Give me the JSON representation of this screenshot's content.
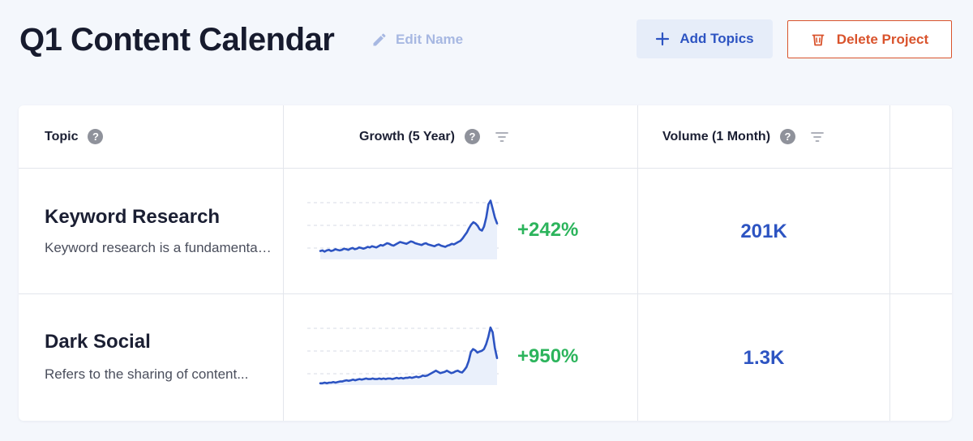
{
  "header": {
    "title": "Q1 Content Calendar",
    "edit_label": "Edit Name",
    "add_topics_label": "Add Topics",
    "delete_project_label": "Delete Project"
  },
  "table": {
    "columns": [
      "Topic",
      "Growth (5 Year)",
      "Volume (1 Month)"
    ],
    "help_glyph": "?",
    "rows": [
      {
        "name": "Keyword Research",
        "description": "Keyword research is a fundamental...",
        "growth": "+242%",
        "volume": "201K",
        "trend": [
          14,
          15,
          13,
          15,
          16,
          14,
          15,
          17,
          16,
          15,
          16,
          18,
          17,
          16,
          18,
          19,
          17,
          18,
          20,
          19,
          18,
          19,
          21,
          20,
          22,
          21,
          20,
          22,
          24,
          23,
          25,
          27,
          26,
          24,
          23,
          25,
          27,
          29,
          28,
          27,
          26,
          28,
          30,
          29,
          27,
          26,
          25,
          24,
          26,
          27,
          25,
          24,
          23,
          22,
          24,
          25,
          23,
          22,
          21,
          23,
          24,
          26,
          25,
          27,
          29,
          31,
          35,
          40,
          45,
          52,
          58,
          62,
          60,
          56,
          50,
          48,
          55,
          70,
          92,
          98,
          84,
          70,
          60
        ]
      },
      {
        "name": "Dark Social",
        "description": "Refers to the sharing of content...",
        "growth": "+950%",
        "volume": "1.3K",
        "trend": [
          3,
          3,
          4,
          3,
          4,
          4,
          5,
          4,
          5,
          6,
          6,
          7,
          8,
          7,
          8,
          9,
          8,
          9,
          10,
          9,
          10,
          11,
          10,
          10,
          11,
          10,
          10,
          11,
          10,
          11,
          10,
          11,
          11,
          10,
          11,
          12,
          11,
          12,
          11,
          12,
          12,
          13,
          12,
          13,
          14,
          13,
          14,
          16,
          15,
          16,
          18,
          20,
          22,
          24,
          22,
          20,
          21,
          22,
          24,
          22,
          20,
          21,
          23,
          24,
          22,
          21,
          25,
          30,
          40,
          55,
          60,
          58,
          54,
          56,
          57,
          60,
          68,
          80,
          96,
          88,
          62,
          45
        ]
      }
    ]
  },
  "colors": {
    "accent": "#2d54c2",
    "growth": "#2cb45c",
    "danger": "#d9532c",
    "muted": "#a7b8e2"
  },
  "icons": {
    "edit": "pencil-icon",
    "add": "plus-icon",
    "delete": "trash-icon",
    "help": "help-icon",
    "filter": "filter-icon"
  }
}
